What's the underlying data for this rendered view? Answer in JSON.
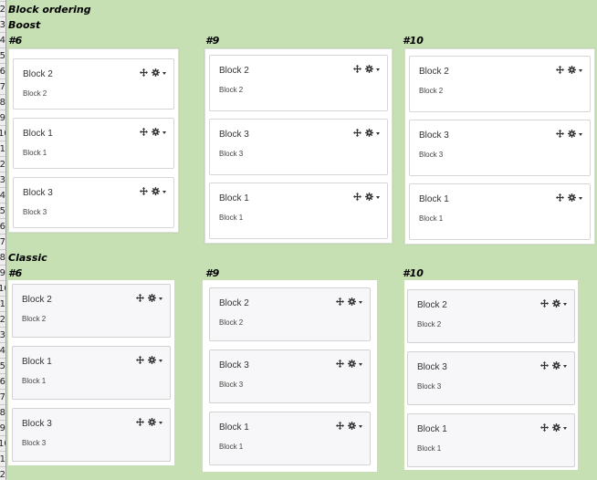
{
  "row_numbers": [
    "2",
    "3",
    "4",
    "5",
    "6",
    "7",
    "8",
    "9",
    "10",
    "1",
    "2",
    "3",
    "4",
    "5",
    "6",
    "7",
    "8",
    "9",
    "10",
    "1",
    "2",
    "3",
    "4",
    "5",
    "6",
    "7",
    "8",
    "9",
    "10",
    "1",
    "2"
  ],
  "labels": {
    "title": "Block ordering",
    "boost": "Boost",
    "classic": "Classic"
  },
  "boost": [
    {
      "version": "#6",
      "blocks": [
        {
          "title": "Block 2",
          "body": "Block 2"
        },
        {
          "title": "Block 1",
          "body": "Block 1"
        },
        {
          "title": "Block 3",
          "body": "Block 3"
        }
      ]
    },
    {
      "version": "#9",
      "blocks": [
        {
          "title": "Block 2",
          "body": "Block 2"
        },
        {
          "title": "Block 3",
          "body": "Block 3"
        },
        {
          "title": "Block 1",
          "body": "Block 1"
        }
      ]
    },
    {
      "version": "#10",
      "blocks": [
        {
          "title": "Block 2",
          "body": "Block 2"
        },
        {
          "title": "Block 3",
          "body": "Block 3"
        },
        {
          "title": "Block 1",
          "body": "Block 1"
        }
      ]
    }
  ],
  "classic": [
    {
      "version": "#6",
      "blocks": [
        {
          "title": "Block 2",
          "body": "Block 2"
        },
        {
          "title": "Block 1",
          "body": "Block 1"
        },
        {
          "title": "Block 3",
          "body": "Block 3"
        }
      ]
    },
    {
      "version": "#9",
      "blocks": [
        {
          "title": "Block 2",
          "body": "Block 2"
        },
        {
          "title": "Block 3",
          "body": "Block 3"
        },
        {
          "title": "Block 1",
          "body": "Block 1"
        }
      ]
    },
    {
      "version": "#10",
      "blocks": [
        {
          "title": "Block 2",
          "body": "Block 2"
        },
        {
          "title": "Block 3",
          "body": "Block 3"
        },
        {
          "title": "Block 1",
          "body": "Block 1"
        }
      ]
    }
  ],
  "icons": {
    "move": "move-icon",
    "gear": "gear-icon",
    "caret": "caret-down-icon"
  },
  "colors": {
    "sheet_background": "#c6e0b4",
    "panel_background": "#ffffff",
    "classic_card_background": "#f7f7f9"
  }
}
